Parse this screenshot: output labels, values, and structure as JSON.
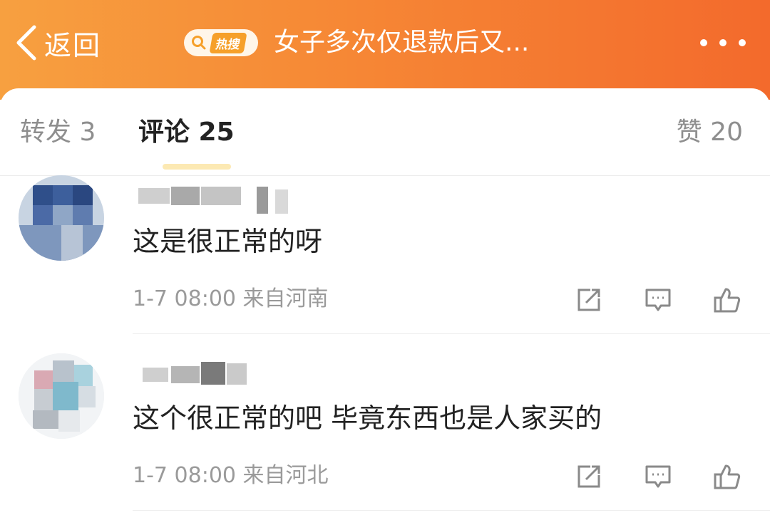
{
  "header": {
    "back_label": "返回",
    "hot_label": "热搜",
    "title": "女子多次仅退款后又...",
    "colors": {
      "gradient_start": "#f7a040",
      "gradient_end": "#f36a2c"
    }
  },
  "tabs": {
    "repost": "转发 3",
    "comments": "评论 25",
    "likes": "赞 20"
  },
  "comments": [
    {
      "text": "这是很正常的呀",
      "meta": "1-7 08:00 来自河南",
      "icons": [
        "repost-icon",
        "comment-icon",
        "like-icon"
      ]
    },
    {
      "text": "这个很正常的吧 毕竟东西也是人家买的",
      "meta": "1-7 08:00 来自河北",
      "icons": [
        "repost-icon",
        "comment-icon",
        "like-icon"
      ]
    }
  ]
}
